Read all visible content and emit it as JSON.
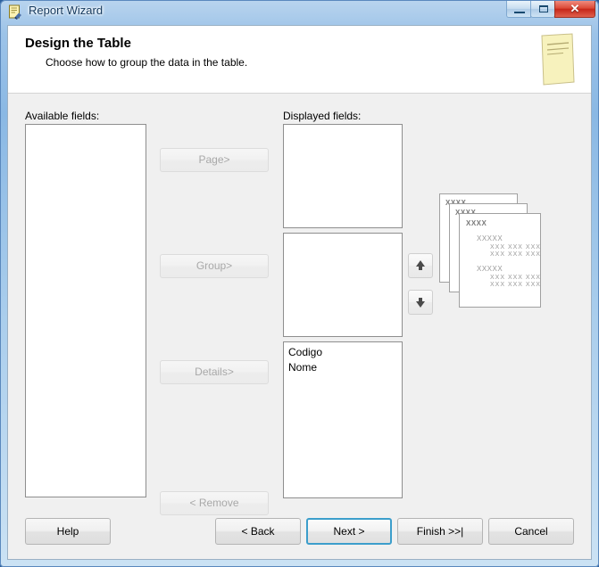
{
  "window": {
    "title": "Report Wizard",
    "icon": "report-wizard-icon",
    "controls": {
      "minimize": "—",
      "maximize": "□",
      "close": "✕"
    }
  },
  "header": {
    "title": "Design the Table",
    "subtitle": "Choose how to group the data in the table.",
    "icon": "yellow-document-icon"
  },
  "labels": {
    "available": "Available fields:",
    "displayed": "Displayed fields:"
  },
  "lists": {
    "available": {
      "items": []
    },
    "page": {
      "items": []
    },
    "group": {
      "items": []
    },
    "details": {
      "items": [
        "Codigo",
        "Nome"
      ]
    }
  },
  "buttons": {
    "page": "Page>",
    "group": "Group>",
    "details": "Details>",
    "remove": "< Remove",
    "move_up": "move-up-arrow",
    "move_down": "move-down-arrow"
  },
  "footer": {
    "help": "Help",
    "back": "< Back",
    "next": "Next >",
    "finish": "Finish >>|",
    "cancel": "Cancel"
  },
  "preview": {
    "pages": [
      {
        "title": "XXXX"
      },
      {
        "title": "XXXX"
      },
      {
        "title": "XXXX",
        "groups": [
          {
            "label": "XXXXX",
            "rows": [
              "XXX XXX XXX",
              "XXX XXX XXX"
            ]
          },
          {
            "label": "XXXXX",
            "rows": [
              "XXX XXX XXX",
              "XXX XXX XXX"
            ]
          }
        ]
      }
    ]
  },
  "colors": {
    "accent": "#3c9ecb",
    "title_text": "#14395e",
    "close_button": "#c6271a",
    "panel": "#f0f0f0"
  }
}
